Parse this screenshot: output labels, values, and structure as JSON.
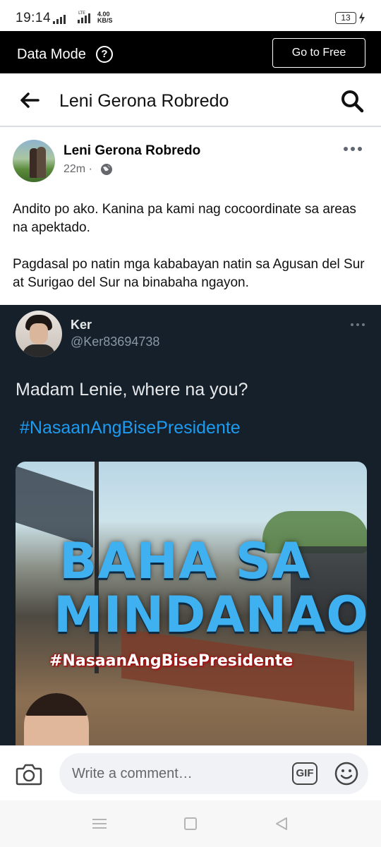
{
  "status_bar": {
    "time": "19:14",
    "network_type": "LTE",
    "net_speed_value": "4.00",
    "net_speed_unit": "KB/S",
    "battery_level": "13"
  },
  "data_mode": {
    "label": "Data Mode",
    "help_symbol": "?",
    "go_to_free_label": "Go to Free"
  },
  "header": {
    "title": "Leni Gerona Robredo"
  },
  "post": {
    "author": "Leni Gerona Robredo",
    "time_ago": "22m",
    "separator": "·",
    "privacy_icon": "globe-icon",
    "paragraphs": [
      "Andito po ako. Kanina pa kami nag cocoordinate sa areas na apektado.",
      "Pagdasal po natin mga kababayan natin sa Agusan del Sur at Surigao del Sur na binabaha ngayon."
    ]
  },
  "tweet": {
    "name": "Ker",
    "handle": "@Ker83694738",
    "text": "Madam Lenie, where na you?",
    "hashtag": "#NasaanAngBisePresidente",
    "photo": {
      "headline_line1": "BAHA SA",
      "headline_line2": "MINDANAO",
      "tag": "#NasaanAngBisePresidente"
    }
  },
  "comment_bar": {
    "placeholder": "Write a comment…",
    "gif_label": "GIF"
  },
  "colors": {
    "data_mode_bg": "#000000",
    "tweet_bg": "#15202b",
    "tweet_link": "#1d9bf0",
    "headline_blue": "#3fb0f0",
    "meta_gray": "#65676b"
  }
}
